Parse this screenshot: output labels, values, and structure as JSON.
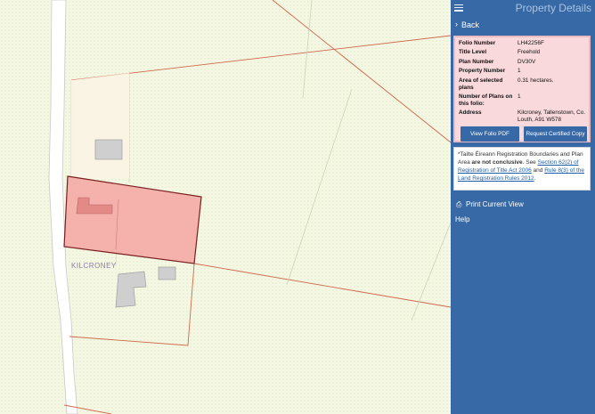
{
  "panel": {
    "title": "Property Details",
    "back_label": "Back",
    "details": [
      {
        "label": "Folio Number",
        "value": "LH42256F"
      },
      {
        "label": "Title Level",
        "value": "Freehold"
      },
      {
        "label": "Plan Number",
        "value": "DV30V"
      },
      {
        "label": "Property Number",
        "value": "1"
      },
      {
        "label": "Area of selected plans",
        "value": "0.31 hectares."
      },
      {
        "label": "Number of Plans on this folio:",
        "value": "1"
      },
      {
        "label": "Address",
        "value": "Kilcroney, Tallenstown, Co. Louth, A91 W578"
      }
    ],
    "view_pdf_label": "View Folio PDF",
    "certified_copy_label": "Request Certified Copy",
    "note": {
      "part1": "*Tailte Éireann Registration Boundaries and Plan Area ",
      "bold": "are not conclusive",
      "part2": ". See ",
      "link1": "Section 62(2) of Registration of Title Act 2006",
      "part3": " and ",
      "link2": "Rule 8(3) of the Land Registration Rules 2012",
      "part4": "."
    },
    "print_label": "Print Current View",
    "help_label": "Help"
  },
  "map": {
    "place_label": "KILCRONEY"
  }
}
